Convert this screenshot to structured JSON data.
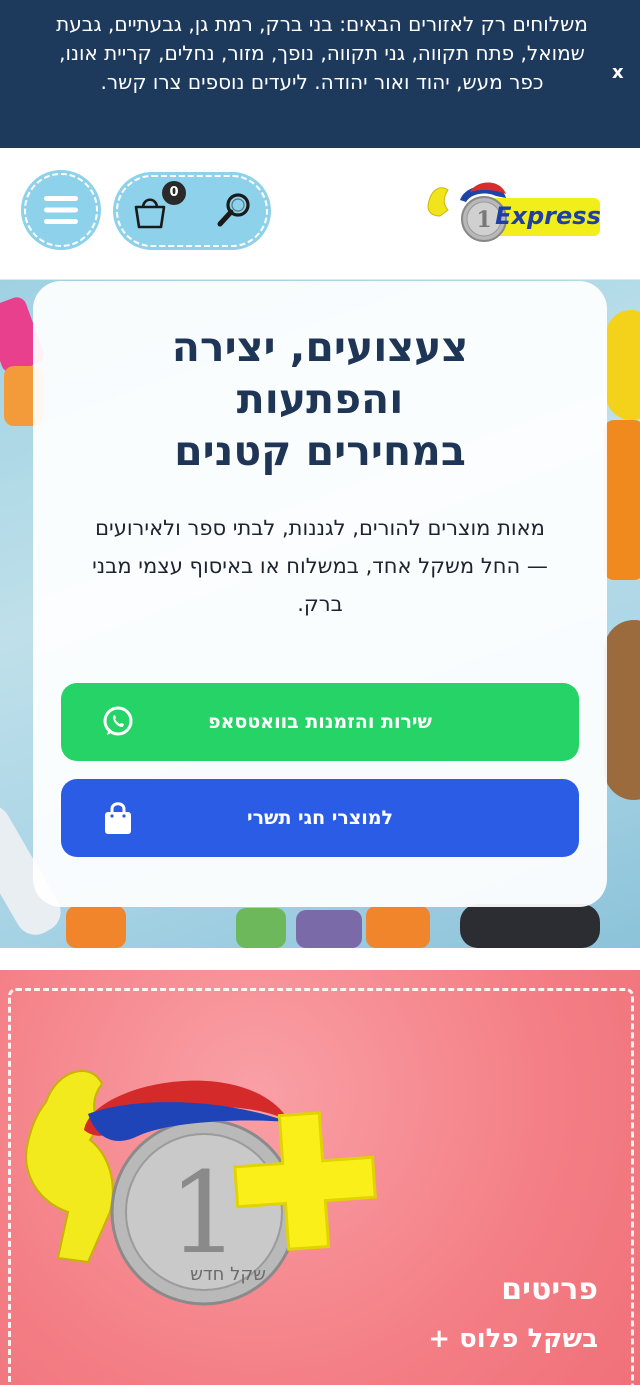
{
  "announcement": {
    "text": "משלוחים רק לאזורים הבאים: בני ברק, רמת גן, גבעתיים, גבעת שמואל, פתח תקווה, גני תקווה, נופך, מזור, נחלים, קריית אונו, כפר מעש, יהוד ואור יהודה. ליעדים נוספים צרו קשר.",
    "close_label": "x"
  },
  "header": {
    "cart_count": "0",
    "logo_text": "Express",
    "logo_coin": "1"
  },
  "hero": {
    "title_line1": "צעצועים, יצירה",
    "title_line2": "והפתעות",
    "title_line3": "במחירים קטנים",
    "subtitle": "מאות מוצרים להורים, לגננות, לבתי ספר ולאירועים — החל משקל אחד, במשלוח או באיסוף עצמי מבני ברק.",
    "whatsapp_button": "שירות והזמנות בוואטסאפ",
    "shop_button": "למוצרי חגי תשרי"
  },
  "promo": {
    "title": "פריטים",
    "subtitle": "בשקל פלוס +",
    "coin_text": "שקל חדש",
    "coin_number": "1"
  },
  "colors": {
    "announcement_bg": "#1d3a5c",
    "accent_blue": "#8dd2ea",
    "whatsapp_green": "#25d366",
    "shop_blue": "#2b5ce6",
    "promo_pink": "#f47f86",
    "title_navy": "#1f3556"
  }
}
